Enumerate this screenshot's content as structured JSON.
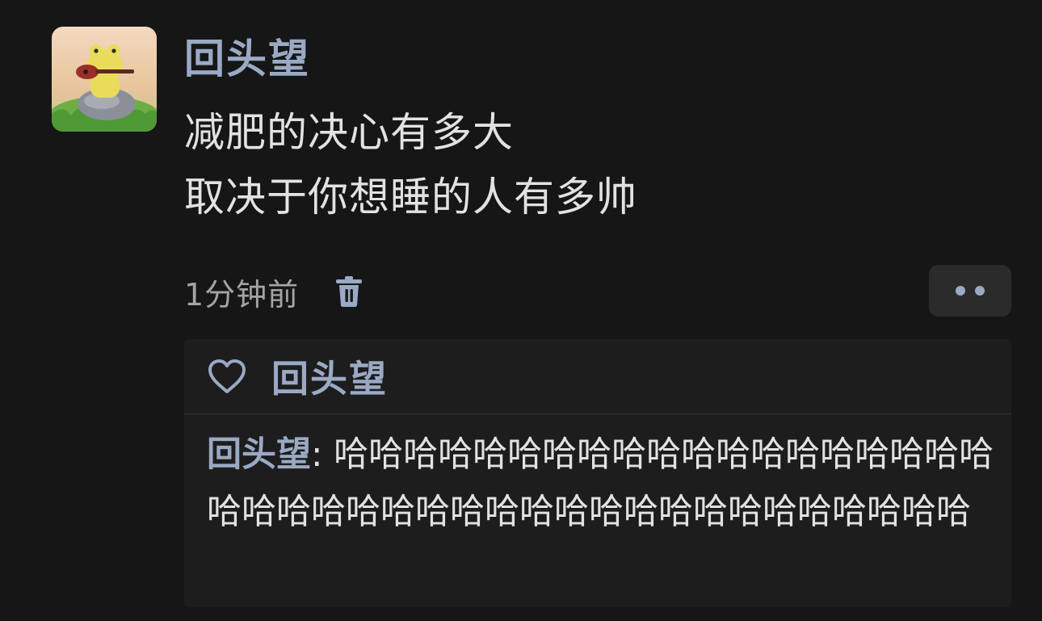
{
  "post": {
    "author": "回头望",
    "lines": [
      "减肥的决心有多大",
      "取决于你想睡的人有多帅"
    ],
    "timestamp": "1分钟前"
  },
  "icons": {
    "avatar": "cartoon-frog-with-guitar-avatar",
    "delete": "trash-icon",
    "more": "more-dots-icon",
    "like": "heart-outline-icon"
  },
  "likes": {
    "users": "回头望"
  },
  "comments": [
    {
      "author": "回头望",
      "separator": ": ",
      "text": "哈哈哈哈哈哈哈哈哈哈哈哈哈哈哈哈哈哈哈哈哈哈哈哈哈哈哈哈哈哈哈哈哈哈哈哈哈哈哈哈哈"
    }
  ],
  "colors": {
    "background": "#161616",
    "accent_name": "#9aa9c4",
    "text": "#e2e2e2",
    "muted": "#a4a4a4",
    "panel": "#1d1d1d"
  }
}
